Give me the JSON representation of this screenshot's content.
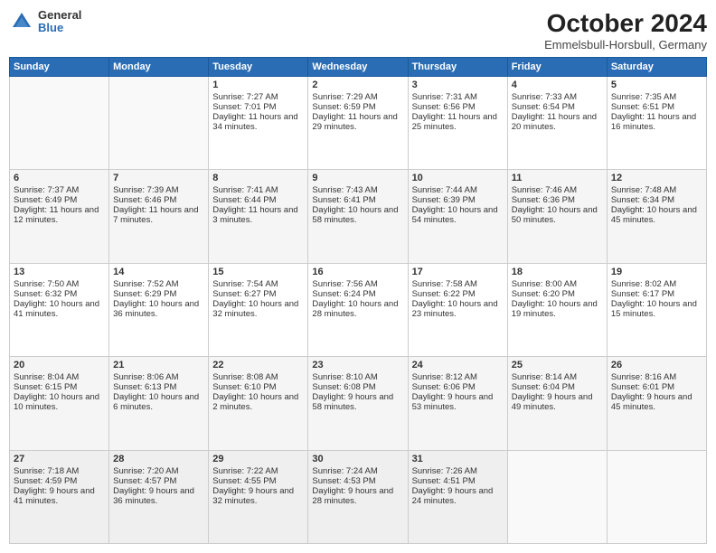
{
  "header": {
    "logo_general": "General",
    "logo_blue": "Blue",
    "title": "October 2024",
    "subtitle": "Emmelsbull-Horsbull, Germany"
  },
  "days_of_week": [
    "Sunday",
    "Monday",
    "Tuesday",
    "Wednesday",
    "Thursday",
    "Friday",
    "Saturday"
  ],
  "weeks": [
    [
      {
        "day": "",
        "sunrise": "",
        "sunset": "",
        "daylight": ""
      },
      {
        "day": "",
        "sunrise": "",
        "sunset": "",
        "daylight": ""
      },
      {
        "day": "1",
        "sunrise": "Sunrise: 7:27 AM",
        "sunset": "Sunset: 7:01 PM",
        "daylight": "Daylight: 11 hours and 34 minutes."
      },
      {
        "day": "2",
        "sunrise": "Sunrise: 7:29 AM",
        "sunset": "Sunset: 6:59 PM",
        "daylight": "Daylight: 11 hours and 29 minutes."
      },
      {
        "day": "3",
        "sunrise": "Sunrise: 7:31 AM",
        "sunset": "Sunset: 6:56 PM",
        "daylight": "Daylight: 11 hours and 25 minutes."
      },
      {
        "day": "4",
        "sunrise": "Sunrise: 7:33 AM",
        "sunset": "Sunset: 6:54 PM",
        "daylight": "Daylight: 11 hours and 20 minutes."
      },
      {
        "day": "5",
        "sunrise": "Sunrise: 7:35 AM",
        "sunset": "Sunset: 6:51 PM",
        "daylight": "Daylight: 11 hours and 16 minutes."
      }
    ],
    [
      {
        "day": "6",
        "sunrise": "Sunrise: 7:37 AM",
        "sunset": "Sunset: 6:49 PM",
        "daylight": "Daylight: 11 hours and 12 minutes."
      },
      {
        "day": "7",
        "sunrise": "Sunrise: 7:39 AM",
        "sunset": "Sunset: 6:46 PM",
        "daylight": "Daylight: 11 hours and 7 minutes."
      },
      {
        "day": "8",
        "sunrise": "Sunrise: 7:41 AM",
        "sunset": "Sunset: 6:44 PM",
        "daylight": "Daylight: 11 hours and 3 minutes."
      },
      {
        "day": "9",
        "sunrise": "Sunrise: 7:43 AM",
        "sunset": "Sunset: 6:41 PM",
        "daylight": "Daylight: 10 hours and 58 minutes."
      },
      {
        "day": "10",
        "sunrise": "Sunrise: 7:44 AM",
        "sunset": "Sunset: 6:39 PM",
        "daylight": "Daylight: 10 hours and 54 minutes."
      },
      {
        "day": "11",
        "sunrise": "Sunrise: 7:46 AM",
        "sunset": "Sunset: 6:36 PM",
        "daylight": "Daylight: 10 hours and 50 minutes."
      },
      {
        "day": "12",
        "sunrise": "Sunrise: 7:48 AM",
        "sunset": "Sunset: 6:34 PM",
        "daylight": "Daylight: 10 hours and 45 minutes."
      }
    ],
    [
      {
        "day": "13",
        "sunrise": "Sunrise: 7:50 AM",
        "sunset": "Sunset: 6:32 PM",
        "daylight": "Daylight: 10 hours and 41 minutes."
      },
      {
        "day": "14",
        "sunrise": "Sunrise: 7:52 AM",
        "sunset": "Sunset: 6:29 PM",
        "daylight": "Daylight: 10 hours and 36 minutes."
      },
      {
        "day": "15",
        "sunrise": "Sunrise: 7:54 AM",
        "sunset": "Sunset: 6:27 PM",
        "daylight": "Daylight: 10 hours and 32 minutes."
      },
      {
        "day": "16",
        "sunrise": "Sunrise: 7:56 AM",
        "sunset": "Sunset: 6:24 PM",
        "daylight": "Daylight: 10 hours and 28 minutes."
      },
      {
        "day": "17",
        "sunrise": "Sunrise: 7:58 AM",
        "sunset": "Sunset: 6:22 PM",
        "daylight": "Daylight: 10 hours and 23 minutes."
      },
      {
        "day": "18",
        "sunrise": "Sunrise: 8:00 AM",
        "sunset": "Sunset: 6:20 PM",
        "daylight": "Daylight: 10 hours and 19 minutes."
      },
      {
        "day": "19",
        "sunrise": "Sunrise: 8:02 AM",
        "sunset": "Sunset: 6:17 PM",
        "daylight": "Daylight: 10 hours and 15 minutes."
      }
    ],
    [
      {
        "day": "20",
        "sunrise": "Sunrise: 8:04 AM",
        "sunset": "Sunset: 6:15 PM",
        "daylight": "Daylight: 10 hours and 10 minutes."
      },
      {
        "day": "21",
        "sunrise": "Sunrise: 8:06 AM",
        "sunset": "Sunset: 6:13 PM",
        "daylight": "Daylight: 10 hours and 6 minutes."
      },
      {
        "day": "22",
        "sunrise": "Sunrise: 8:08 AM",
        "sunset": "Sunset: 6:10 PM",
        "daylight": "Daylight: 10 hours and 2 minutes."
      },
      {
        "day": "23",
        "sunrise": "Sunrise: 8:10 AM",
        "sunset": "Sunset: 6:08 PM",
        "daylight": "Daylight: 9 hours and 58 minutes."
      },
      {
        "day": "24",
        "sunrise": "Sunrise: 8:12 AM",
        "sunset": "Sunset: 6:06 PM",
        "daylight": "Daylight: 9 hours and 53 minutes."
      },
      {
        "day": "25",
        "sunrise": "Sunrise: 8:14 AM",
        "sunset": "Sunset: 6:04 PM",
        "daylight": "Daylight: 9 hours and 49 minutes."
      },
      {
        "day": "26",
        "sunrise": "Sunrise: 8:16 AM",
        "sunset": "Sunset: 6:01 PM",
        "daylight": "Daylight: 9 hours and 45 minutes."
      }
    ],
    [
      {
        "day": "27",
        "sunrise": "Sunrise: 7:18 AM",
        "sunset": "Sunset: 4:59 PM",
        "daylight": "Daylight: 9 hours and 41 minutes."
      },
      {
        "day": "28",
        "sunrise": "Sunrise: 7:20 AM",
        "sunset": "Sunset: 4:57 PM",
        "daylight": "Daylight: 9 hours and 36 minutes."
      },
      {
        "day": "29",
        "sunrise": "Sunrise: 7:22 AM",
        "sunset": "Sunset: 4:55 PM",
        "daylight": "Daylight: 9 hours and 32 minutes."
      },
      {
        "day": "30",
        "sunrise": "Sunrise: 7:24 AM",
        "sunset": "Sunset: 4:53 PM",
        "daylight": "Daylight: 9 hours and 28 minutes."
      },
      {
        "day": "31",
        "sunrise": "Sunrise: 7:26 AM",
        "sunset": "Sunset: 4:51 PM",
        "daylight": "Daylight: 9 hours and 24 minutes."
      },
      {
        "day": "",
        "sunrise": "",
        "sunset": "",
        "daylight": ""
      },
      {
        "day": "",
        "sunrise": "",
        "sunset": "",
        "daylight": ""
      }
    ]
  ]
}
